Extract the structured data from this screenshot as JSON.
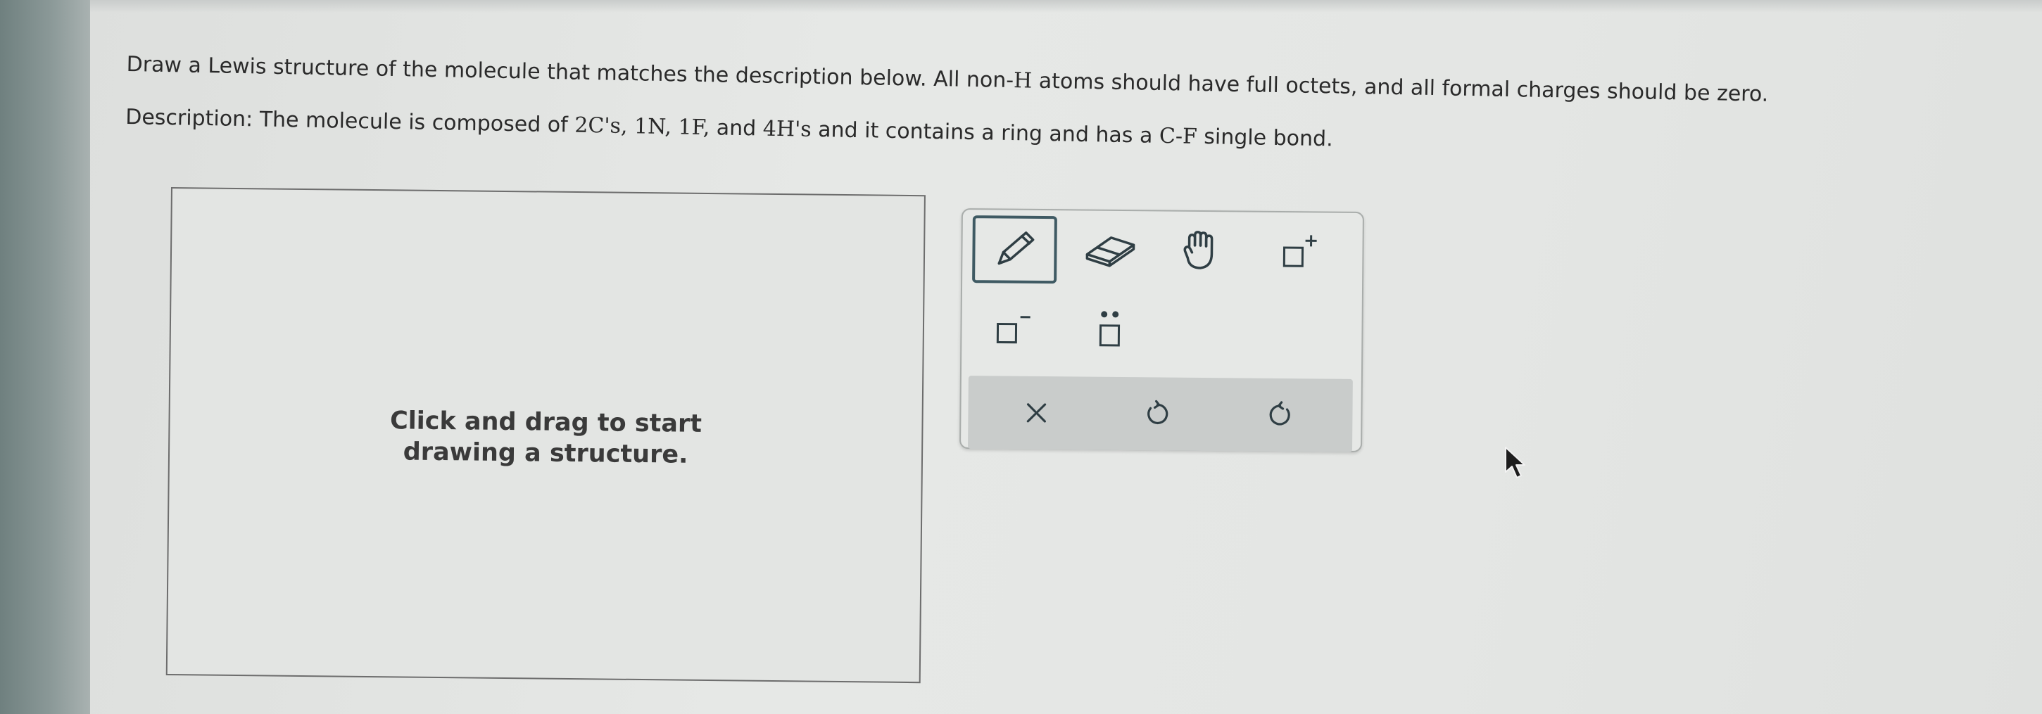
{
  "question": {
    "instruction_parts": [
      "Draw a Lewis structure of the molecule that matches the description below. All non-",
      "H",
      " atoms should have full octets, and all formal charges should be zero."
    ],
    "description_parts": [
      "Description: The molecule is composed of ",
      "2C's, 1N, 1F,",
      " and ",
      "4H's",
      " and it contains a ring and has a ",
      "C-F",
      " single bond."
    ]
  },
  "canvas": {
    "hint_line1": "Click and drag to start",
    "hint_line2": "drawing a structure."
  },
  "toolbar": {
    "tools": [
      {
        "name": "pencil-tool",
        "icon": "pencil-icon",
        "selected": true
      },
      {
        "name": "eraser-tool",
        "icon": "eraser-icon",
        "selected": false
      },
      {
        "name": "hand-tool",
        "icon": "hand-icon",
        "selected": false
      },
      {
        "name": "add-positive-charge-tool",
        "icon": "positive-charge-icon",
        "selected": false
      },
      {
        "name": "add-negative-charge-tool",
        "icon": "negative-charge-icon",
        "selected": false
      },
      {
        "name": "add-lone-pair-tool",
        "icon": "lone-pair-icon",
        "selected": false
      }
    ],
    "actions": [
      {
        "name": "clear",
        "icon": "close-icon"
      },
      {
        "name": "undo",
        "icon": "undo-icon"
      },
      {
        "name": "redo",
        "icon": "redo-icon"
      }
    ]
  },
  "colors": {
    "selected_border": "#3f5a63",
    "icon_stroke": "#2f3e44",
    "actions_bar": "#c9cccb"
  }
}
